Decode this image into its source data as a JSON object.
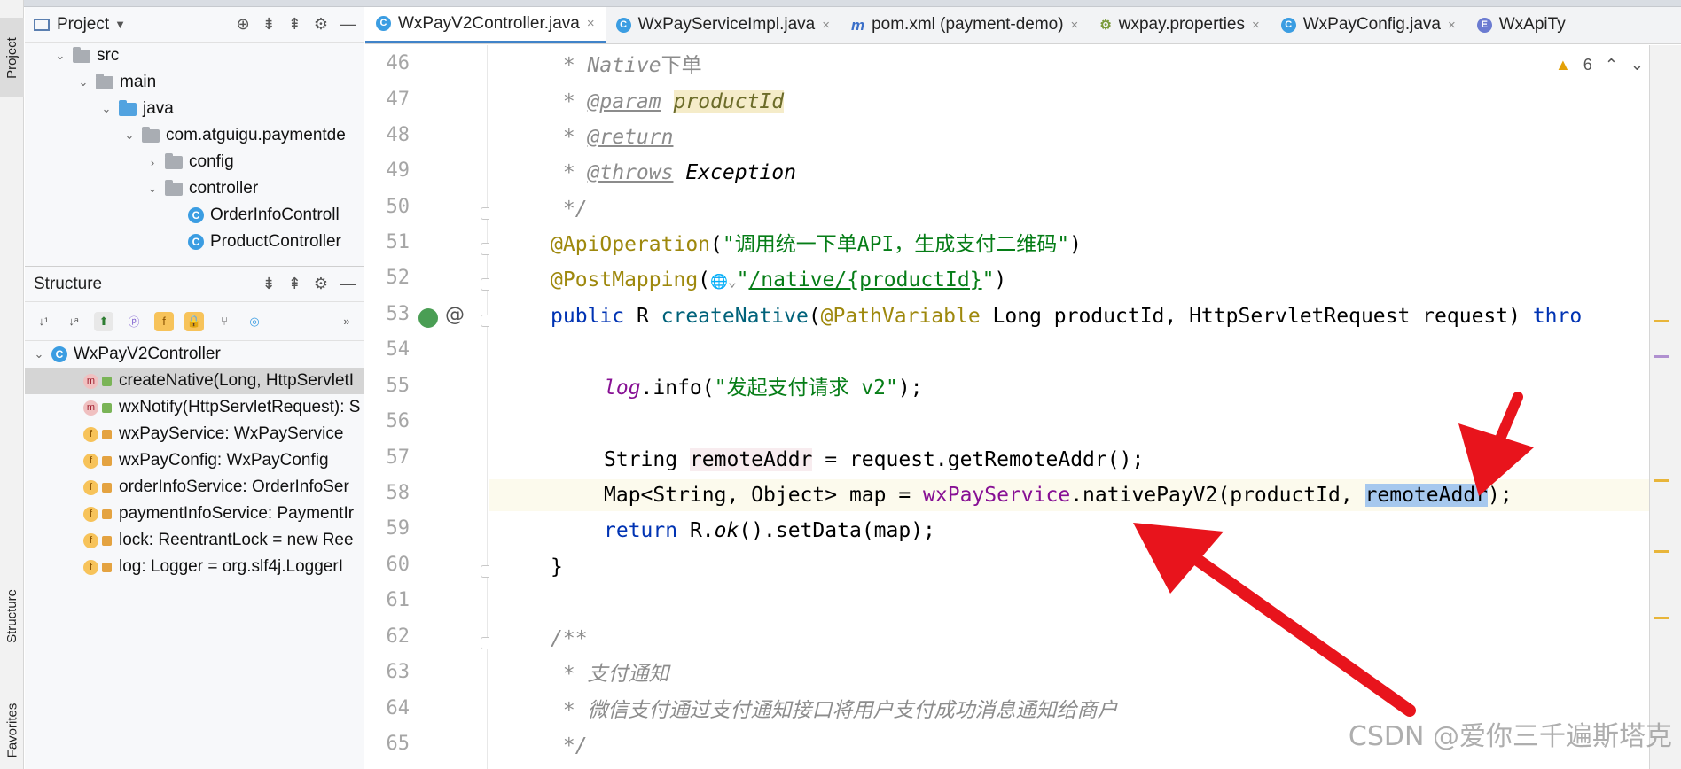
{
  "left_strip": {
    "project_tab": "Project",
    "structure_tab": "Structure",
    "favorites_tab": "Favorites"
  },
  "project": {
    "title": "Project",
    "tree": [
      {
        "label": "src",
        "depth": 0,
        "expanded": true,
        "icon": "folder"
      },
      {
        "label": "main",
        "depth": 1,
        "expanded": true,
        "icon": "folder"
      },
      {
        "label": "java",
        "depth": 2,
        "expanded": true,
        "icon": "folder-blue"
      },
      {
        "label": "com.atguigu.paymentde",
        "depth": 3,
        "expanded": true,
        "icon": "package"
      },
      {
        "label": "config",
        "depth": 4,
        "expanded": false,
        "icon": "package"
      },
      {
        "label": "controller",
        "depth": 4,
        "expanded": true,
        "icon": "package"
      },
      {
        "label": "OrderInfoControll",
        "depth": 5,
        "icon": "class"
      },
      {
        "label": "ProductController",
        "depth": 5,
        "icon": "class"
      }
    ]
  },
  "structure": {
    "title": "Structure",
    "root": "WxPayV2Controller",
    "members": [
      {
        "label": "createNative(Long, HttpServletI",
        "kind": "m",
        "selected": true
      },
      {
        "label": "wxNotify(HttpServletRequest): S",
        "kind": "m"
      },
      {
        "label": "wxPayService: WxPayService",
        "kind": "f"
      },
      {
        "label": "wxPayConfig: WxPayConfig",
        "kind": "f"
      },
      {
        "label": "orderInfoService: OrderInfoSer",
        "kind": "f"
      },
      {
        "label": "paymentInfoService: PaymentIr",
        "kind": "f"
      },
      {
        "label": "lock: ReentrantLock = new Ree",
        "kind": "f"
      },
      {
        "label": "log: Logger = org.slf4j.LoggerI",
        "kind": "f"
      }
    ]
  },
  "tabs": [
    {
      "label": "WxPayV2Controller.java",
      "icon": "C",
      "active": true
    },
    {
      "label": "WxPayServiceImpl.java",
      "icon": "C"
    },
    {
      "label": "pom.xml (payment-demo)",
      "icon": "m"
    },
    {
      "label": "wxpay.properties",
      "icon": "p"
    },
    {
      "label": "WxPayConfig.java",
      "icon": "C"
    },
    {
      "label": "WxApiTy",
      "icon": "E"
    }
  ],
  "inspection": {
    "warnings": "6"
  },
  "line_numbers": [
    "46",
    "47",
    "48",
    "49",
    "50",
    "51",
    "52",
    "53",
    "54",
    "55",
    "56",
    "57",
    "58",
    "59",
    "60",
    "61",
    "62",
    "63",
    "64",
    "65"
  ],
  "code": {
    "l46_star": " * ",
    "l46_native": "Native",
    "l46_cn": "下单",
    "l47_star": " * ",
    "l47_tag": "@param",
    "l47_name": "productId",
    "l48_star": " * ",
    "l48_tag": "@return",
    "l49_star": " * ",
    "l49_tag": "@throws",
    "l49_ex": " Exception",
    "l50": " */",
    "l51_an": "@ApiOperation",
    "l51_p1": "(",
    "l51_str": "\"调用统一下单API，生成支付二维码\"",
    "l51_p2": ")",
    "l52_an": "@PostMapping",
    "l52_p1": "(",
    "l52_globe": "🌐⌄",
    "l52_q1": "\"",
    "l52_path": "/native/{productId}",
    "l52_q2": "\"",
    "l52_p2": ")",
    "l53_kw": "public",
    "l53_type": " R ",
    "l53_fn": "createNative",
    "l53_p1": "(",
    "l53_an": "@PathVariable",
    "l53_rest": " Long productId, HttpServletRequest request) ",
    "l53_thr": "thro",
    "l55_log": "log",
    "l55_mid": ".info(",
    "l55_str": "\"发起支付请求 v2\"",
    "l55_end": ");",
    "l57_a": "String ",
    "l57_var": "remoteAddr",
    "l57_b": " = request.getRemoteAddr();",
    "l58_a": "Map<String, Object> map = ",
    "l58_fld": "wxPayService",
    "l58_b": ".nativePayV2(productId, ",
    "l58_sel": "remoteAddr",
    "l58_c": ");",
    "l59_kw": "return",
    "l59_a": " R.",
    "l59_ok": "ok",
    "l59_b": "().setData(map);",
    "l60": "}",
    "l62": "/**",
    "l63_star": " * ",
    "l63_cn": "支付通知",
    "l64_star": " * ",
    "l64_cn": "微信支付通过支付通知接口将用户支付成功消息通知给商户",
    "l65": " */"
  },
  "watermark": "CSDN @爱你三千遍斯塔克",
  "colors": {
    "keyword": "#0033b3",
    "annotation": "#9e880d",
    "string": "#067d17",
    "field": "#871094",
    "comment": "#8c8c8c",
    "selection": "#a6c8ee",
    "arrow": "#e8141c",
    "active_tab_underline": "#4083c9"
  }
}
